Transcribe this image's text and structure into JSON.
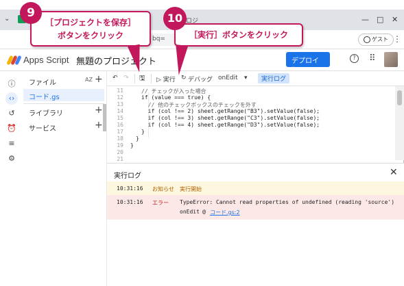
{
  "browser": {
    "tab_text": "プロジ",
    "url_text": "bq=",
    "guest_label": "ゲスト",
    "window_controls": [
      "—",
      "□",
      "✕"
    ]
  },
  "app": {
    "name": "Apps Script",
    "project_title": "無題のプロジェクト",
    "deploy_label": "デプロイ ▾"
  },
  "files_panel": {
    "header": "ファイル",
    "sort_label": "AZ",
    "file_name": "コード.gs",
    "library_label": "ライブラリ",
    "service_label": "サービス"
  },
  "toolbar": {
    "run_label": "▷ 実行",
    "debug_label": "デバッグ",
    "function_select": "onEdit",
    "log_label": "実行ログ"
  },
  "editor": {
    "lines": [
      {
        "no": "11",
        "text": "// チェックが入った場合"
      },
      {
        "no": "12",
        "text": "if (value === true) {"
      },
      {
        "no": "13",
        "text": "  // 他のチェックボックスのチェックを外す"
      },
      {
        "no": "14",
        "text": "  if (col !== 2) sheet.getRange(\"B3\").setValue(false);"
      },
      {
        "no": "15",
        "text": "  if (col !== 3) sheet.getRange(\"C3\").setValue(false);"
      },
      {
        "no": "16",
        "text": "  if (col !== 4) sheet.getRange(\"D3\").setValue(false);"
      },
      {
        "no": "17",
        "text": "}"
      },
      {
        "no": "18",
        "text": "}"
      },
      {
        "no": "19",
        "text": "}"
      },
      {
        "no": "20",
        "text": ""
      },
      {
        "no": "21",
        "text": ""
      }
    ]
  },
  "log_panel": {
    "title": "実行ログ",
    "rows": [
      {
        "time": "10:31:16",
        "level": "お知らせ",
        "message": "実行開始"
      },
      {
        "time": "10:31:16",
        "level": "エラー",
        "message": "TypeError: Cannot read properties of undefined (reading 'source')",
        "trace_fn": "onEdit",
        "trace_at": "@",
        "trace_link": "コード.gs:2"
      }
    ]
  },
  "callouts": {
    "save": {
      "number": "9",
      "line1": "［プロジェクトを保存］",
      "line2": "ボタンをクリック"
    },
    "run": {
      "number": "10",
      "text": "［実行］ボタンをクリック"
    }
  },
  "colors": {
    "accent": "#1a73e8",
    "callout": "#c2185b",
    "info_row": "#fef7e0",
    "error_row": "#fce8e6"
  }
}
